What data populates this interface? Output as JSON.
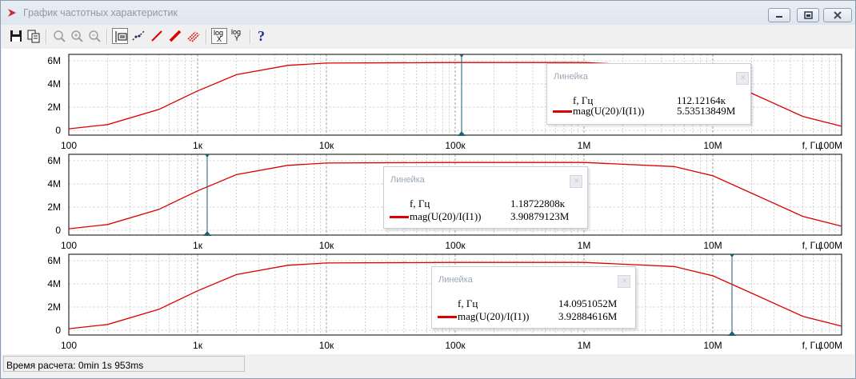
{
  "window": {
    "title": "График частотных характеристик"
  },
  "toolbar": {
    "log_x": "log",
    "log_x_axis": "X",
    "log_y": "log",
    "log_y_axis": "Y",
    "help": "?"
  },
  "colors": {
    "curve": "#dd0000",
    "cursor": "#1f5f6f",
    "grid": "#b8b8b8"
  },
  "chart_data": [
    {
      "type": "line",
      "x_scale": "log",
      "xlim": [
        100,
        100000000
      ],
      "ylim": [
        0,
        6000000
      ],
      "xlabel": "f, Гц",
      "x_ticks": [
        "100",
        "1к",
        "10к",
        "100к",
        "1M",
        "10M",
        "100M"
      ],
      "y_ticks": [
        "0",
        "2M",
        "4M",
        "6M"
      ],
      "series": [
        {
          "name": "mag(U(20)/I(I1))",
          "x": [
            100,
            200,
            500,
            1000,
            2000,
            5000,
            10000,
            100000,
            1000000,
            5000000,
            10000000,
            20000000,
            50000000,
            100000000
          ],
          "y": [
            130000,
            500000,
            1800000,
            3400000,
            4800000,
            5600000,
            5800000,
            5850000,
            5850000,
            5500000,
            4700000,
            3200000,
            1200000,
            350000
          ]
        }
      ],
      "cursor": {
        "x_label": "f, Гц",
        "x_value": "112.12164к",
        "y_label": "mag(U(20)/I(I1))",
        "y_value": "5.53513849M",
        "x": 112121.64,
        "y": 5535138.49,
        "title": "Линейка"
      }
    },
    {
      "type": "line",
      "x_scale": "log",
      "xlim": [
        100,
        100000000
      ],
      "ylim": [
        0,
        6000000
      ],
      "xlabel": "f, Гц",
      "x_ticks": [
        "100",
        "1к",
        "10к",
        "100к",
        "1M",
        "10M",
        "100M"
      ],
      "y_ticks": [
        "0",
        "2M",
        "4M",
        "6M"
      ],
      "series": [
        {
          "name": "mag(U(20)/I(I1))",
          "x": [
            100,
            200,
            500,
            1000,
            2000,
            5000,
            10000,
            100000,
            1000000,
            5000000,
            10000000,
            20000000,
            50000000,
            100000000
          ],
          "y": [
            130000,
            500000,
            1800000,
            3400000,
            4800000,
            5600000,
            5800000,
            5850000,
            5850000,
            5500000,
            4700000,
            3200000,
            1200000,
            350000
          ]
        }
      ],
      "cursor": {
        "x_label": "f, Гц",
        "x_value": "1.18722808к",
        "y_label": "mag(U(20)/I(I1))",
        "y_value": "3.90879123M",
        "x": 1187.22808,
        "y": 3908791.23,
        "title": "Линейка"
      }
    },
    {
      "type": "line",
      "x_scale": "log",
      "xlim": [
        100,
        100000000
      ],
      "ylim": [
        0,
        6000000
      ],
      "xlabel": "f, Гц",
      "x_ticks": [
        "100",
        "1к",
        "10к",
        "100к",
        "1M",
        "10M",
        "100M"
      ],
      "y_ticks": [
        "0",
        "2M",
        "4M",
        "6M"
      ],
      "series": [
        {
          "name": "mag(U(20)/I(I1))",
          "x": [
            100,
            200,
            500,
            1000,
            2000,
            5000,
            10000,
            100000,
            1000000,
            5000000,
            10000000,
            20000000,
            50000000,
            100000000
          ],
          "y": [
            130000,
            500000,
            1800000,
            3400000,
            4800000,
            5600000,
            5800000,
            5850000,
            5850000,
            5500000,
            4700000,
            3200000,
            1200000,
            350000
          ]
        }
      ],
      "cursor": {
        "x_label": "f, Гц",
        "x_value": "14.0951052M",
        "y_label": "mag(U(20)/I(I1))",
        "y_value": "3.92884616M",
        "x": 14095105.2,
        "y": 3928846.16,
        "title": "Линейка"
      }
    }
  ],
  "status": {
    "text": "Время расчета: 0min 1s 953ms"
  }
}
